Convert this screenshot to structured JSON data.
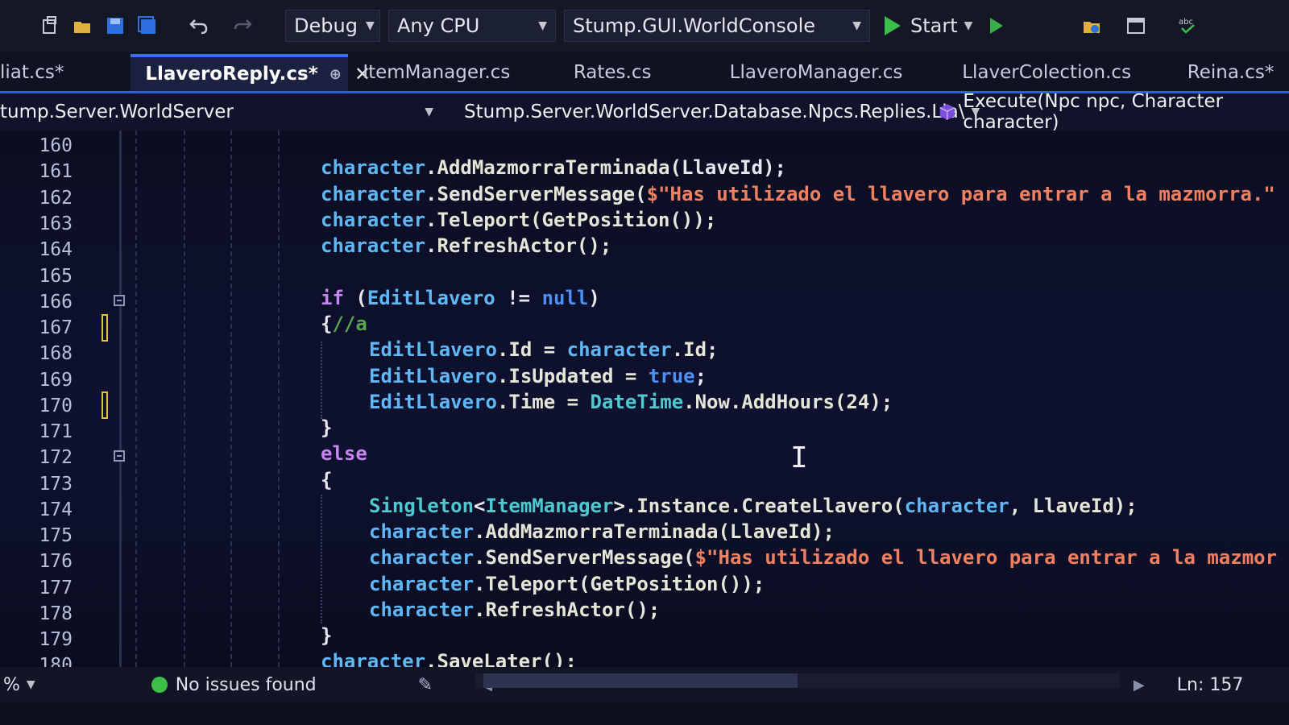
{
  "toolbar": {
    "config": "Debug",
    "platform": "Any CPU",
    "startup_project": "Stump.GUI.WorldConsole",
    "start_label": "Start"
  },
  "tabs": [
    {
      "label": "liat.cs*"
    },
    {
      "label": "LlaveroReply.cs*",
      "active": true
    },
    {
      "label": "ItemManager.cs"
    },
    {
      "label": "Rates.cs"
    },
    {
      "label": "LlaveroManager.cs"
    },
    {
      "label": "LlaverColection.cs"
    },
    {
      "label": "Reina.cs*"
    }
  ],
  "navbar": {
    "project": "tump.Server.WorldServer",
    "type": "Stump.Server.WorldServer.Database.Npcs.Replies.Lla\\",
    "member": "Execute(Npc npc, Character character)"
  },
  "editor": {
    "line_numbers": [
      "160",
      "161",
      "162",
      "163",
      "164",
      "165",
      "166",
      "167",
      "168",
      "169",
      "170",
      "171",
      "172",
      "173",
      "174",
      "175",
      "176",
      "177",
      "178",
      "179",
      "180"
    ],
    "lines": {
      "l161": {
        "obj": "character",
        "method": ".AddMazmorraTerminada(",
        "arg": "LlaveId",
        "end": ");"
      },
      "l162": {
        "obj": "character",
        "method": ".SendServerMessage(",
        "str": "$\"Has utilizado el llavero para entrar a la mazmorra.\""
      },
      "l163": {
        "obj": "character",
        "method": ".Teleport(GetPosition());"
      },
      "l164": {
        "obj": "character",
        "method": ".RefreshActor();"
      },
      "l166": {
        "kw": "if",
        "open": " (",
        "var": "EditLlavero",
        "op": " != ",
        "null": "null",
        "close": ")"
      },
      "l167": {
        "brace": "{",
        "comment": "//a"
      },
      "l168": {
        "var": "EditLlavero",
        "prop": ".Id = ",
        "obj": "character",
        "rest": ".Id;"
      },
      "l169": {
        "var": "EditLlavero",
        "prop": ".IsUpdated = ",
        "val": "true",
        "end": ";"
      },
      "l170": {
        "var": "EditLlavero",
        "prop": ".Time = ",
        "type": "DateTime",
        "rest": ".Now.AddHours(24);"
      },
      "l171": {
        "brace": "}"
      },
      "l172": {
        "kw": "else"
      },
      "l173": {
        "brace": "{"
      },
      "l174": {
        "type": "Singleton",
        "lt": "<",
        "type2": "ItemManager",
        "rest": ">.Instance.CreateLlavero(",
        "obj": "character",
        "rest2": ", LlaveId);"
      },
      "l175": {
        "obj": "character",
        "method": ".AddMazmorraTerminada(LlaveId);"
      },
      "l176": {
        "obj": "character",
        "method": ".SendServerMessage(",
        "str": "$\"Has utilizado el llavero para entrar a la mazmor"
      },
      "l177": {
        "obj": "character",
        "method": ".Teleport(GetPosition());"
      },
      "l178": {
        "obj": "character",
        "method": ".RefreshActor();"
      },
      "l179": {
        "brace": "}"
      },
      "l180": {
        "obj": "character",
        "method": ".SaveLater();"
      }
    }
  },
  "status": {
    "zoom": "%",
    "issues": "No issues found",
    "line_col": "Ln: 157"
  },
  "colors": {
    "keyword": "#c685f0",
    "variable": "#5fb8f5",
    "type": "#4ec9d0",
    "string": "#f08060",
    "accent": "#2f5fd8",
    "ok": "#3cc04a",
    "change_marker": "#e8c32a"
  },
  "icons": [
    "new-project-icon",
    "open-folder-icon",
    "save-icon",
    "save-all-icon",
    "undo-icon",
    "redo-icon",
    "start-play-icon",
    "start-without-debug-icon",
    "solution-explorer-icon",
    "window-layout-icon",
    "spell-check-icon",
    "class-icon",
    "method-cube-icon",
    "no-issues-icon",
    "scroll-left-icon",
    "scroll-right-icon"
  ]
}
